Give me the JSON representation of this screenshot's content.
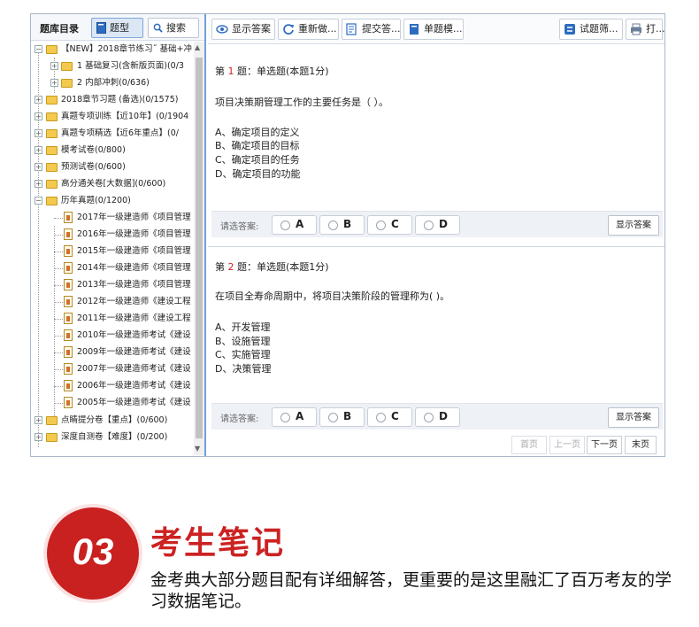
{
  "left_panel": {
    "title": "题库目录",
    "tab_type": "题型",
    "tab_search": "搜索",
    "tree": [
      {
        "label": "【NEW】2018章节练习˝ 基础+冲"
      },
      {
        "label": "1 基础复习(含新版页面)(0/3"
      },
      {
        "label": "2 内部冲刺(0/636)"
      },
      {
        "label": "2018章节习题 (备选)(0/1575)"
      },
      {
        "label": "真题专项训练【近10年】(0/1904"
      },
      {
        "label": "真题专项精选【近6年重点】(0/"
      },
      {
        "label": "模考试卷(0/800)"
      },
      {
        "label": "预测试卷(0/600)"
      },
      {
        "label": "高分通关卷[大数据](0/600)"
      },
      {
        "label": "历年真题(0/1200)"
      },
      {
        "label": "2017年一级建造师《项目管理"
      },
      {
        "label": "2016年一级建造师《项目管理"
      },
      {
        "label": "2015年一级建造师《项目管理"
      },
      {
        "label": "2014年一级建造师《项目管理"
      },
      {
        "label": "2013年一级建造师《项目管理"
      },
      {
        "label": "2012年一级建造师《建设工程"
      },
      {
        "label": "2011年一级建造师《建设工程"
      },
      {
        "label": "2010年一级建造师考试《建设"
      },
      {
        "label": "2009年一级建造师考试《建设"
      },
      {
        "label": "2007年一级建造师考试《建设"
      },
      {
        "label": "2006年一级建造师考试《建设"
      },
      {
        "label": "2005年一级建造师考试《建设"
      },
      {
        "label": "点睛提分卷【重点】(0/600)"
      },
      {
        "label": "深度自测卷【难度】(0/200)"
      }
    ]
  },
  "toolbar": {
    "show_answer": "显示答案",
    "redo": "重新做...",
    "submit": "提交答...",
    "single_mode": "单题模...",
    "filter": "试题筛...",
    "print": "打..."
  },
  "questions": [
    {
      "prefix": "第 ",
      "number": "1",
      "suffix": " 题：单选题(本题1分)",
      "text": "项目决策期管理工作的主要任务是（ ）。",
      "options": [
        "A、确定项目的定义",
        "B、确定项目的目标",
        "C、确定项目的任务",
        "D、确定项目的功能"
      ]
    },
    {
      "prefix": "第 ",
      "number": "2",
      "suffix": " 题：单选题(本题1分)",
      "text": "在项目全寿命周期中，将项目决策阶段的管理称为( )。",
      "options": [
        "A、开发管理",
        "B、设施管理",
        "C、实施管理",
        "D、决策管理"
      ]
    }
  ],
  "answer_bar": {
    "label": "请选答案:",
    "choices": [
      "A",
      "B",
      "C",
      "D"
    ],
    "show_answer": "显示答案"
  },
  "pager": {
    "first": "首页",
    "prev": "上一页",
    "next": "下一页",
    "last": "末页"
  },
  "promo": {
    "number": "03",
    "title": "考生笔记",
    "description": "金考典大部分题目配有详细解答，更重要的是这里融汇了百万考友的学习数据笔记。"
  },
  "colors": {
    "accent": "#6fa0d8",
    "question_number": "#d21e1e",
    "promo_red": "#c92020"
  }
}
